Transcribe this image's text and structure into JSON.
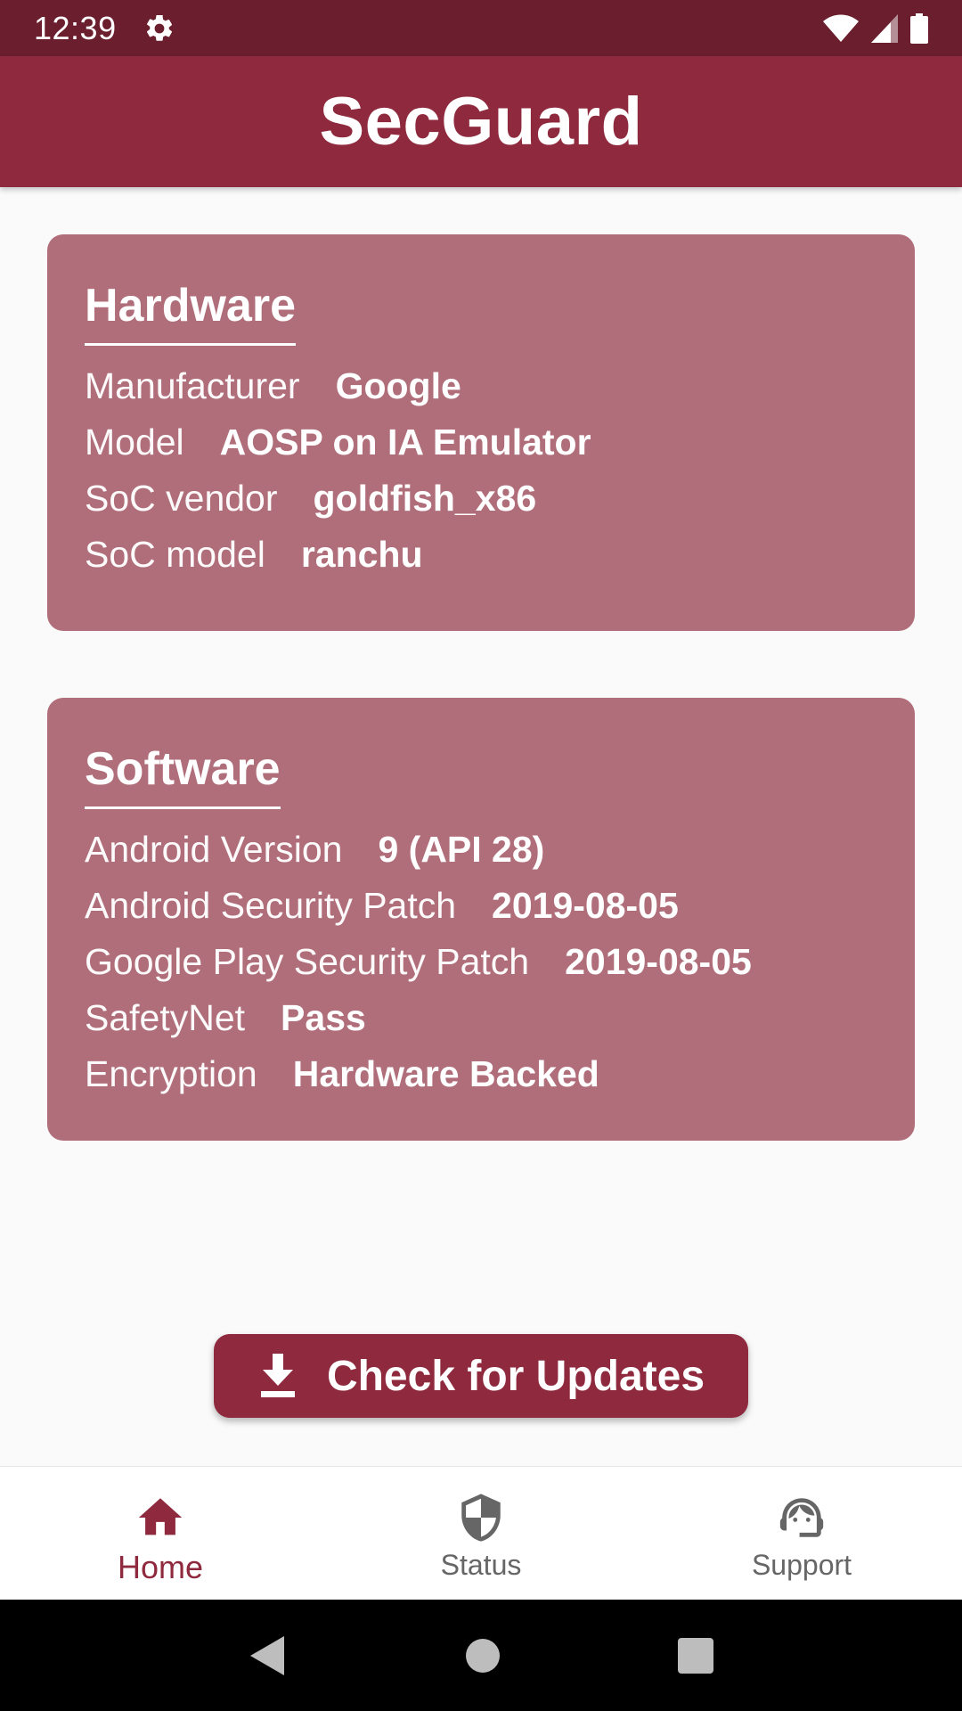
{
  "status_bar": {
    "time": "12:39"
  },
  "app_bar": {
    "title": "SecGuard"
  },
  "hardware": {
    "title": "Hardware",
    "rows": [
      {
        "label": "Manufacturer",
        "value": "Google"
      },
      {
        "label": "Model",
        "value": "AOSP on IA Emulator"
      },
      {
        "label": "SoC vendor",
        "value": "goldfish_x86"
      },
      {
        "label": "SoC model",
        "value": "ranchu"
      }
    ]
  },
  "software": {
    "title": "Software",
    "rows": [
      {
        "label": "Android Version",
        "value": "9 (API 28)"
      },
      {
        "label": "Android Security Patch",
        "value": "2019-08-05"
      },
      {
        "label": "Google Play Security Patch",
        "value": "2019-08-05"
      },
      {
        "label": "SafetyNet",
        "value": "Pass"
      },
      {
        "label": "Encryption",
        "value": "Hardware Backed"
      }
    ]
  },
  "update_button": {
    "label": "Check for Updates",
    "icon": "download-icon"
  },
  "bottom_nav": {
    "items": [
      {
        "label": "Home",
        "icon": "home-icon",
        "active": true
      },
      {
        "label": "Status",
        "icon": "shield-icon",
        "active": false
      },
      {
        "label": "Support",
        "icon": "support-agent-icon",
        "active": false
      }
    ]
  },
  "colors": {
    "status_bar": "#6b1f2e",
    "primary": "#8f2a3e",
    "card": "#b06e7a",
    "background": "#fafafa"
  }
}
